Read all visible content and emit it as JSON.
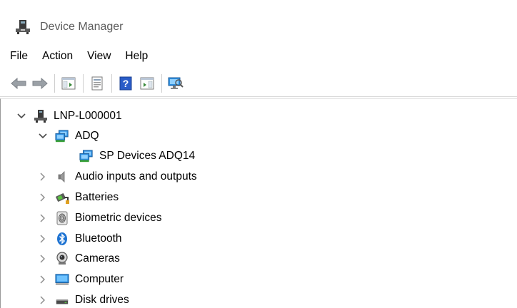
{
  "window": {
    "title": "Device Manager"
  },
  "menu": {
    "items": [
      {
        "label": "File"
      },
      {
        "label": "Action"
      },
      {
        "label": "View"
      },
      {
        "label": "Help"
      }
    ]
  },
  "toolbar": {
    "buttons": [
      {
        "icon": "back-arrow-icon"
      },
      {
        "icon": "forward-arrow-icon"
      },
      {
        "icon": "show-hide-console-tree-icon"
      },
      {
        "icon": "properties-icon"
      },
      {
        "icon": "help-icon"
      },
      {
        "icon": "run-icon"
      },
      {
        "icon": "scan-hardware-changes-icon"
      }
    ]
  },
  "tree": {
    "root": {
      "label": "LNP-L000001",
      "expanded": true,
      "icon": "computer-tower-icon"
    },
    "children": [
      {
        "label": "ADQ",
        "expanded": true,
        "icon": "network-monitor-icon",
        "children": [
          {
            "label": "SP Devices ADQ14",
            "icon": "network-monitor-icon"
          }
        ]
      },
      {
        "label": "Audio inputs and outputs",
        "expanded": false,
        "icon": "speaker-icon"
      },
      {
        "label": "Batteries",
        "expanded": false,
        "icon": "battery-icon"
      },
      {
        "label": "Biometric devices",
        "expanded": false,
        "icon": "fingerprint-icon"
      },
      {
        "label": "Bluetooth",
        "expanded": false,
        "icon": "bluetooth-icon"
      },
      {
        "label": "Cameras",
        "expanded": false,
        "icon": "camera-icon"
      },
      {
        "label": "Computer",
        "expanded": false,
        "icon": "monitor-icon"
      },
      {
        "label": "Disk drives",
        "expanded": false,
        "icon": "disk-drive-icon"
      }
    ]
  },
  "colors": {
    "accent_blue": "#1e73d2",
    "chevron_gray": "#6b6b6b",
    "title_gray": "#5b5b5b"
  }
}
